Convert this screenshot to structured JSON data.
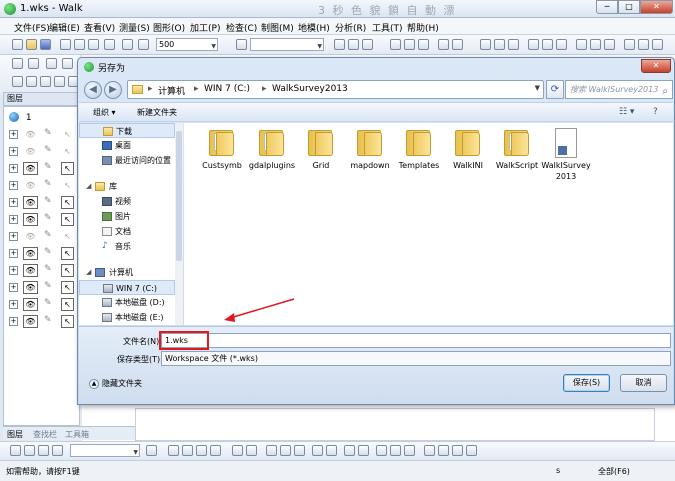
{
  "window": {
    "title": "1.wks - Walk",
    "ghost_title": "3 秒 色 貌 鎖 自 動 漂",
    "min_glyph": "─",
    "max_glyph": "□",
    "close_glyph": "✕"
  },
  "menu": [
    "文件(FS)",
    "编辑(E)",
    "查看(V)",
    "测量(S)",
    "图形(O)",
    "加工(P)",
    "检查(C)",
    "制图(M)",
    "地模(H)",
    "分析(R)",
    "工具(T)",
    "帮助(H)"
  ],
  "toolbar": {
    "scale_value": "500"
  },
  "layers_panel": {
    "title": "图层",
    "root_label": "1",
    "tabs": [
      "图层",
      "查找栏",
      "工具箱"
    ]
  },
  "dialog": {
    "title": "另存为",
    "close_glyph": "✕",
    "address": [
      "计算机",
      "WIN 7 (C:)",
      "WalkSurvey2013"
    ],
    "search_placeholder": "搜索 WalkISurvey2013",
    "organize": "组织 ▾",
    "new_folder": "新建文件夹",
    "nav": {
      "favorites": [
        {
          "label": "下载",
          "icon": "download-folder-icon"
        },
        {
          "label": "桌面",
          "icon": "desktop-icon"
        },
        {
          "label": "最近访问的位置",
          "icon": "recent-places-icon"
        }
      ],
      "library_header": "库",
      "libraries": [
        {
          "label": "视频",
          "icon": "video-library-icon"
        },
        {
          "label": "图片",
          "icon": "pictures-library-icon"
        },
        {
          "label": "文档",
          "icon": "documents-library-icon"
        },
        {
          "label": "音乐",
          "icon": "music-library-icon"
        }
      ],
      "computer_header": "计算机",
      "drives": [
        {
          "label": "WIN 7 (C:)",
          "icon": "drive-c-icon"
        },
        {
          "label": "本地磁盘 (D:)",
          "icon": "drive-d-icon"
        },
        {
          "label": "本地磁盘 (E:)",
          "icon": "drive-e-icon"
        }
      ]
    },
    "files": [
      {
        "name": "Custsymb",
        "type": "folder"
      },
      {
        "name": "gdalplugins",
        "type": "folder"
      },
      {
        "name": "Grid",
        "type": "folder"
      },
      {
        "name": "mapdown",
        "type": "folder"
      },
      {
        "name": "Templates",
        "type": "folder"
      },
      {
        "name": "WalkINI",
        "type": "folder"
      },
      {
        "name": "WalkScript",
        "type": "folder"
      },
      {
        "name": "WalkISurvey2013",
        "type": "shortcut"
      }
    ],
    "filename_label": "文件名(N):",
    "filename_value": "1.wks",
    "filetype_label": "保存类型(T):",
    "filetype_value": "Workspace 文件 (*.wks)",
    "hide_folders": "隐藏文件夹",
    "save_button": "保存(S)",
    "cancel_button": "取消"
  },
  "status": {
    "help": "如需帮助，请按F1键",
    "s": "s",
    "all": "全部(F6)"
  }
}
